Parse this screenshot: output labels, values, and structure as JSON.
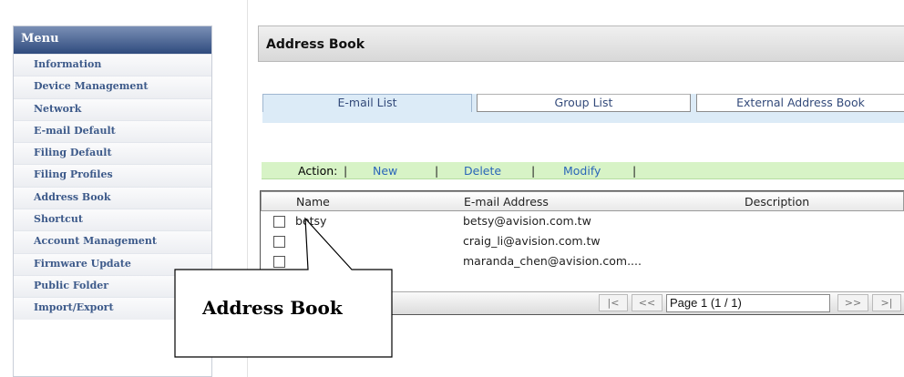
{
  "menu": {
    "title": "Menu",
    "items": [
      {
        "label": "Information"
      },
      {
        "label": "Device Management"
      },
      {
        "label": "Network"
      },
      {
        "label": "E-mail Default"
      },
      {
        "label": "Filing Default"
      },
      {
        "label": "Filing Profiles"
      },
      {
        "label": "Address Book"
      },
      {
        "label": "Shortcut"
      },
      {
        "label": "Account Management"
      },
      {
        "label": "Firmware Update"
      },
      {
        "label": "Public Folder"
      },
      {
        "label": "Import/Export"
      }
    ]
  },
  "header": {
    "title": "Address Book"
  },
  "tabs": [
    {
      "label": "E-mail List",
      "active": true
    },
    {
      "label": "Group List",
      "active": false
    },
    {
      "label": "External Address Book",
      "active": false
    }
  ],
  "actions": {
    "label": "Action:",
    "separator": "|",
    "new": "New",
    "delete": "Delete",
    "modify": "Modify"
  },
  "table": {
    "columns": [
      "Name",
      "E-mail Address",
      "Description"
    ],
    "rows": [
      {
        "name": "betsy",
        "email": "betsy@avision.com.tw",
        "description": ""
      },
      {
        "name": "",
        "email": "craig_li@avision.com.tw",
        "description": ""
      },
      {
        "name": "",
        "email": "maranda_chen@avision.com....",
        "description": ""
      }
    ]
  },
  "pager": {
    "first": "|<",
    "prev": "<<",
    "page_text": "Page 1 (1 / 1)",
    "next": ">>",
    "last": ">|"
  },
  "callout": {
    "label": "Address Book"
  },
  "colors": {
    "menu_header": "#2f4b7e",
    "menu_text": "#3d5a8a",
    "tab_strip": "#dcebf7",
    "action_bar": "#d7f3c6",
    "link": "#2b66b8"
  }
}
